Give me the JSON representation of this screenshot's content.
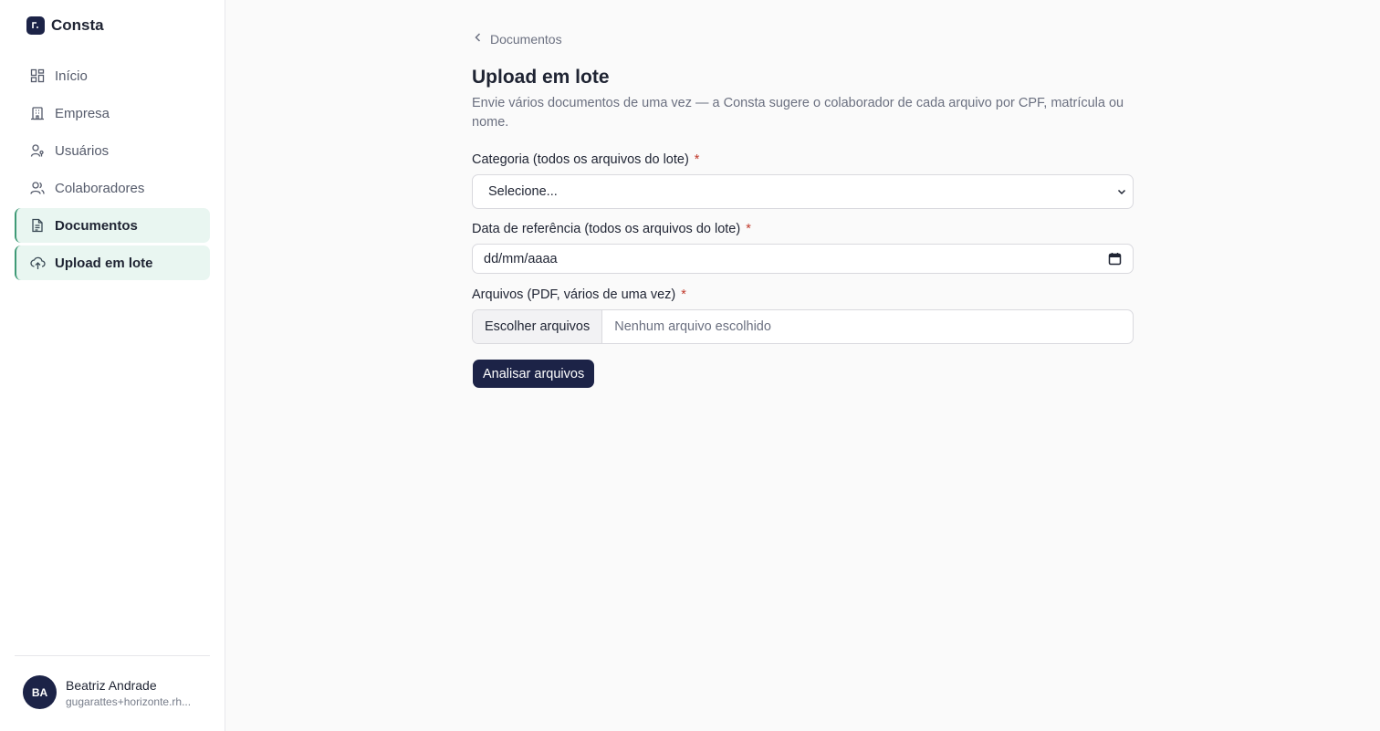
{
  "brand": {
    "name": "Consta"
  },
  "nav": {
    "items": [
      {
        "label": "Início",
        "icon": "dashboard-icon"
      },
      {
        "label": "Empresa",
        "icon": "building-icon"
      },
      {
        "label": "Usuários",
        "icon": "user-key-icon"
      },
      {
        "label": "Colaboradores",
        "icon": "users-icon"
      },
      {
        "label": "Documentos",
        "icon": "document-icon"
      },
      {
        "label": "Upload em lote",
        "icon": "cloud-upload-icon"
      }
    ]
  },
  "user": {
    "initials": "BA",
    "name": "Beatriz Andrade",
    "email": "gugarattes+horizonte.rh..."
  },
  "breadcrumb": {
    "back_label": "Documentos"
  },
  "page": {
    "title": "Upload em lote",
    "description": "Envie vários documentos de uma vez — a Consta sugere o colaborador de cada arquivo por CPF, matrícula ou nome."
  },
  "form": {
    "category": {
      "label": "Categoria (todos os arquivos do lote)",
      "required": "*",
      "value": "Selecione..."
    },
    "date": {
      "label": "Data de referência (todos os arquivos do lote)",
      "required": "*",
      "value": "dd/mm/aaaa"
    },
    "files": {
      "label": "Arquivos (PDF, vários de uma vez)",
      "required": "*",
      "button": "Escolher arquivos",
      "status": "Nenhum arquivo escolhido"
    },
    "submit_label": "Analisar arquivos"
  },
  "colors": {
    "brand": "#1c2347",
    "active_bg": "#e9f6f1",
    "active_border": "#3f9a76",
    "required": "#c0392b"
  }
}
